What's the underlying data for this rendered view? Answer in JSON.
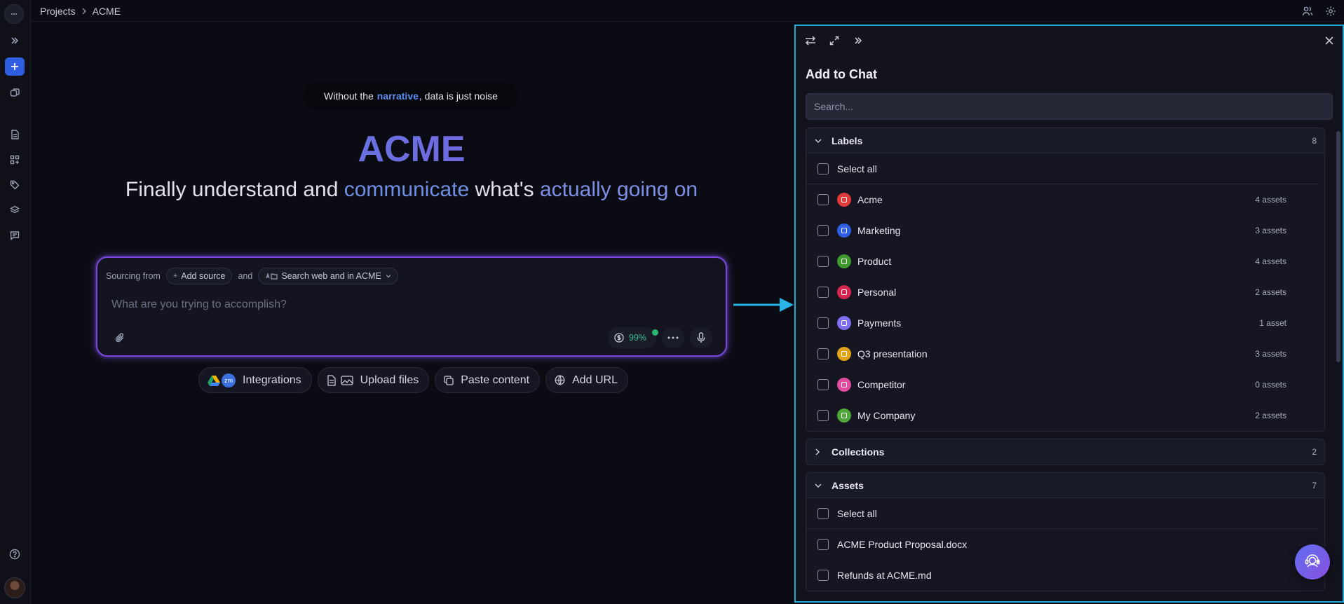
{
  "breadcrumb": {
    "root": "Projects",
    "current": "ACME"
  },
  "hero": {
    "tagline_before": "Without the",
    "tagline_highlight": "narrative",
    "tagline_after": ", data is just noise",
    "brand": "ACME",
    "headline_1": "Finally understand and",
    "headline_2": "communicate",
    "headline_3": "what's",
    "headline_4": "actually going on"
  },
  "prompt": {
    "sourcing_label": "Sourcing from",
    "add_source": "Add source",
    "and_label": "and",
    "scope": "Search web and in ACME",
    "placeholder": "What are you trying to accomplish?",
    "credits": "99%"
  },
  "actions": {
    "integrations": "Integrations",
    "upload": "Upload files",
    "paste": "Paste content",
    "url": "Add URL",
    "zoom_badge": "zm"
  },
  "panel": {
    "title": "Add to Chat",
    "search_placeholder": "Search...",
    "labels": {
      "title": "Labels",
      "count": "8",
      "select_all": "Select all",
      "items": [
        {
          "name": "Acme",
          "meta": "4 assets",
          "color": "#e23b3b"
        },
        {
          "name": "Marketing",
          "meta": "3 assets",
          "color": "#2d5fe0"
        },
        {
          "name": "Product",
          "meta": "4 assets",
          "color": "#3f9a2e"
        },
        {
          "name": "Personal",
          "meta": "2 assets",
          "color": "#d6264f"
        },
        {
          "name": "Payments",
          "meta": "1 asset",
          "color": "#7d6ff0"
        },
        {
          "name": "Q3 presentation",
          "meta": "3 assets",
          "color": "#e2a417"
        },
        {
          "name": "Competitor",
          "meta": "0 assets",
          "color": "#e04ca0"
        },
        {
          "name": "My Company",
          "meta": "2 assets",
          "color": "#4fa73a"
        }
      ]
    },
    "collections": {
      "title": "Collections",
      "count": "2"
    },
    "assets": {
      "title": "Assets",
      "count": "7",
      "select_all": "Select all",
      "items": [
        {
          "name": "ACME Product Proposal.docx"
        },
        {
          "name": "Refunds at ACME.md"
        }
      ]
    }
  }
}
